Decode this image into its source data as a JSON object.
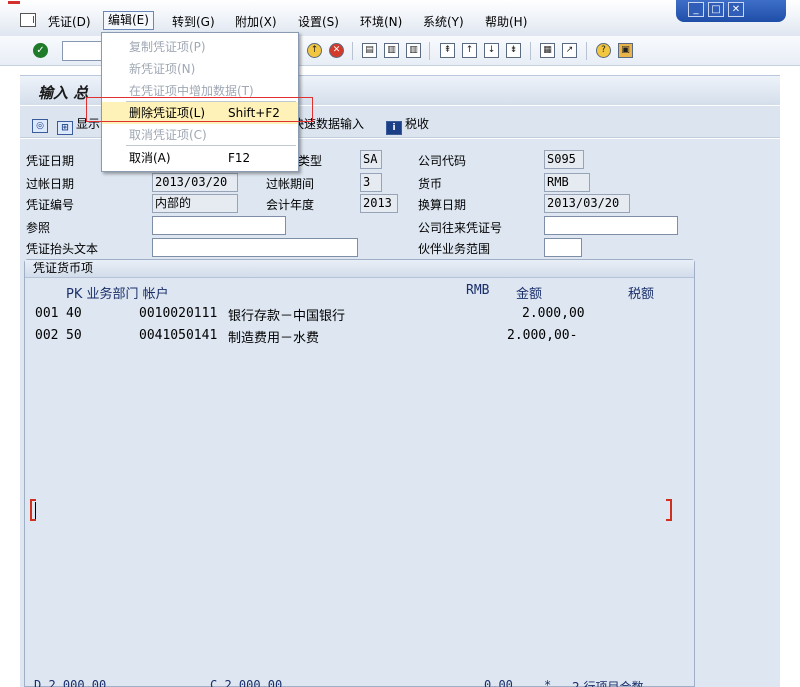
{
  "menubar": {
    "items": [
      "凭证(D)",
      "编辑(E)",
      "转到(G)",
      "附加(X)",
      "设置(S)",
      "环境(N)",
      "系统(Y)",
      "帮助(H)"
    ],
    "active_index": 1
  },
  "window_controls": [
    "minimize",
    "maximize",
    "close"
  ],
  "toolbar": {
    "icons": [
      "enter-icon",
      "save-icon",
      "back-icon",
      "exit-icon",
      "cancel-icon",
      "print-icon",
      "find-icon",
      "find-next-icon",
      "first-page-icon",
      "prev-page-icon",
      "next-page-icon",
      "last-page-icon",
      "new-session-icon",
      "shortcut-icon",
      "help-icon",
      "layout-icon"
    ]
  },
  "title": "输入 总",
  "app_toolbar": {
    "display_label": "显示",
    "quick_entry_label": "快速数据输入",
    "tax_label": "税收"
  },
  "header_form": {
    "doc_date_label": "凭证日期",
    "doc_date": "",
    "doc_type_label": "类型",
    "doc_type": "SA",
    "company_code_label": "公司代码",
    "company_code": "S095",
    "posting_date_label": "过帐日期",
    "posting_date": "2013/03/20",
    "period_label": "过帐期间",
    "period": "3",
    "currency_label": "货币",
    "currency": "RMB",
    "doc_number_label": "凭证编号",
    "doc_number": "内部的",
    "fiscal_year_label": "会计年度",
    "fiscal_year": "2013",
    "translation_date_label": "换算日期",
    "translation_date": "2013/03/20",
    "reference_label": "参照",
    "reference": "",
    "intercompany_label": "公司往来凭证号",
    "intercompany": "",
    "header_text_label": "凭证抬头文本",
    "header_text": "",
    "trading_partner_label": "伙伴业务范围",
    "trading_partner": ""
  },
  "items": {
    "box_title": "凭证货币项",
    "headers": {
      "pk_dept_account": "PK 业务部门 帐户",
      "currency": "RMB",
      "amount": "金额",
      "tax": "税额"
    },
    "rows": [
      {
        "no": "001",
        "pk": "40",
        "account": "0010020111",
        "description": "银行存款－中国银行",
        "amount": "2.000,00"
      },
      {
        "no": "002",
        "pk": "50",
        "account": "0041050141",
        "description": "制造费用－水费",
        "amount": "2.000,00-"
      }
    ],
    "totals": {
      "debit": "D 2.000,00",
      "credit": "C 2.000,00",
      "balance": "0,00",
      "status": "*",
      "line_count": "2 行项目合数"
    }
  },
  "dropdown": {
    "items": [
      {
        "label": "复制凭证项(P)",
        "shortcut": "",
        "disabled": true
      },
      {
        "label": "新凭证项(N)",
        "shortcut": "",
        "disabled": true
      },
      {
        "label": "在凭证项中增加数据(T)",
        "shortcut": "",
        "disabled": true
      },
      {
        "label": "删除凭证项(L)",
        "shortcut": "Shift+F2",
        "disabled": false
      },
      {
        "label": "取消凭证项(C)",
        "shortcut": "",
        "disabled": true
      },
      {
        "label": "取消(A)",
        "shortcut": "F12",
        "disabled": false
      }
    ],
    "highlighted_index": 3
  },
  "colors": {
    "form_background": "#dde6f1",
    "highlight": "#fff2b8",
    "annotation_frame": "#e03030"
  }
}
